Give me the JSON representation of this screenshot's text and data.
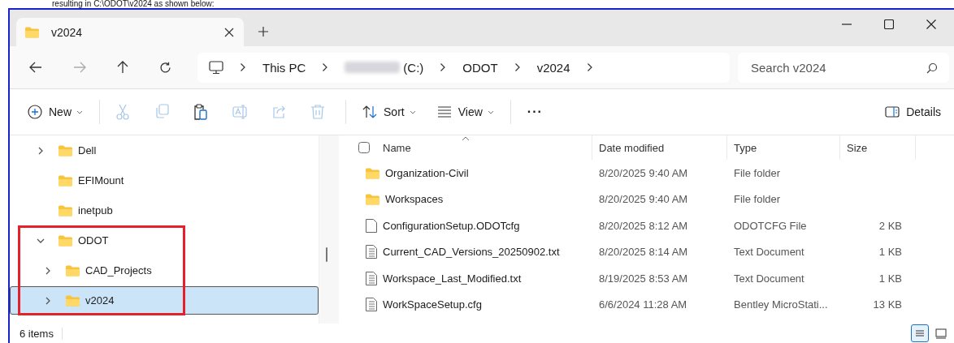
{
  "caption": "resulting in C:\\ODOT\\v2024 as shown below:",
  "window": {
    "tabs": [
      {
        "label": "v2024",
        "selected": true
      }
    ]
  },
  "nav": {
    "back_disabled": false,
    "forward_disabled": true
  },
  "address": {
    "crumbs": [
      {
        "kind": "computer"
      },
      {
        "kind": "text",
        "label": "This PC"
      },
      {
        "kind": "redacted",
        "label": "(C:)"
      },
      {
        "kind": "text",
        "label": "ODOT"
      },
      {
        "kind": "text",
        "label": "v2024"
      }
    ]
  },
  "search": {
    "placeholder": "Search v2024"
  },
  "toolbar": {
    "items": [
      {
        "kind": "new",
        "label": "New"
      },
      {
        "kind": "sep"
      },
      {
        "kind": "cut",
        "disabled": true
      },
      {
        "kind": "copy",
        "disabled": true
      },
      {
        "kind": "paste",
        "disabled": false
      },
      {
        "kind": "rename",
        "disabled": true
      },
      {
        "kind": "share",
        "disabled": true
      },
      {
        "kind": "delete",
        "disabled": true
      },
      {
        "kind": "sep"
      },
      {
        "kind": "sort",
        "label": "Sort"
      },
      {
        "kind": "view",
        "label": "View"
      },
      {
        "kind": "sep"
      },
      {
        "kind": "more",
        "label": "···"
      }
    ],
    "details": "Details"
  },
  "sidebar": {
    "items": [
      {
        "label": "Dell",
        "kind": "expandable",
        "expanded": false,
        "selected": false
      },
      {
        "label": "EFIMount",
        "kind": "leaf",
        "selected": false
      },
      {
        "label": "inetpub",
        "kind": "leaf",
        "selected": false
      },
      {
        "label": "ODOT",
        "kind": "expandable",
        "expanded": true,
        "selected": false,
        "children": [
          {
            "label": "CAD_Projects",
            "kind": "expandable",
            "expanded": false,
            "selected": false
          },
          {
            "label": "v2024",
            "kind": "expandable",
            "expanded": false,
            "selected": true
          }
        ]
      }
    ]
  },
  "table": {
    "columns": [
      {
        "label": "Name",
        "sorted": true
      },
      {
        "label": "Date modified",
        "sorted": false
      },
      {
        "label": "Type",
        "sorted": false
      },
      {
        "label": "Size",
        "sorted": false
      }
    ],
    "rows": [
      {
        "kind": "folder",
        "name": "Organization-Civil",
        "date": "8/20/2025 9:40 AM",
        "type": "File folder"
      },
      {
        "kind": "folder",
        "name": "Workspaces",
        "date": "8/20/2025 9:40 AM",
        "type": "File folder"
      },
      {
        "kind": "file",
        "name": "ConfigurationSetup.ODOTcfg",
        "date": "8/20/2025 8:12 AM",
        "type": "ODOTCFG File",
        "size": "2 KB"
      },
      {
        "kind": "text",
        "name": "Current_CAD_Versions_20250902.txt",
        "date": "8/20/2025 8:14 AM",
        "type": "Text Document",
        "size": "1 KB"
      },
      {
        "kind": "text",
        "name": "Workspace_Last_Modified.txt",
        "date": "8/19/2025 8:53 AM",
        "type": "Text Document",
        "size": "1 KB"
      },
      {
        "kind": "text",
        "name": "WorkSpaceSetup.cfg",
        "date": "6/6/2024 11:28 AM",
        "type": "Bentley MicroStati...",
        "size": "13 KB"
      }
    ]
  },
  "status_bar": {
    "count": "6 items"
  }
}
